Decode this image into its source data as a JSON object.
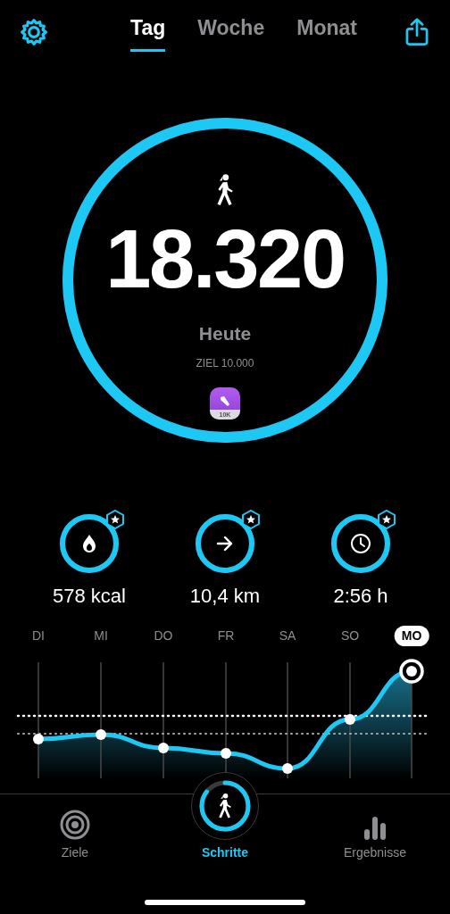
{
  "header": {
    "tabs": [
      {
        "label": "Tag",
        "selected": true
      },
      {
        "label": "Woche",
        "selected": false
      },
      {
        "label": "Monat",
        "selected": false
      }
    ]
  },
  "summary": {
    "steps": "18.320",
    "period": "Heute",
    "goal": "ZIEL 10.000",
    "badge": "10K"
  },
  "stats": [
    {
      "kind": "calories",
      "value": "578 kcal",
      "level": 1,
      "starred": true
    },
    {
      "kind": "distance",
      "value": "10,4 km",
      "level": 1,
      "starred": true
    },
    {
      "kind": "duration",
      "value": "2:56 h",
      "level": 1,
      "starred": true
    }
  ],
  "week": {
    "days": [
      {
        "label": "DI",
        "selected": false
      },
      {
        "label": "MI",
        "selected": false
      },
      {
        "label": "DO",
        "selected": false
      },
      {
        "label": "FR",
        "selected": false
      },
      {
        "label": "SA",
        "selected": false
      },
      {
        "label": "SO",
        "selected": false
      },
      {
        "label": "MO",
        "selected": true
      }
    ]
  },
  "tab_bar": [
    {
      "kind": "goals",
      "label": "Ziele",
      "selected": false
    },
    {
      "kind": "steps",
      "label": "Schritte",
      "selected": true
    },
    {
      "kind": "results",
      "label": "Ergebnisse",
      "selected": false
    }
  ]
}
